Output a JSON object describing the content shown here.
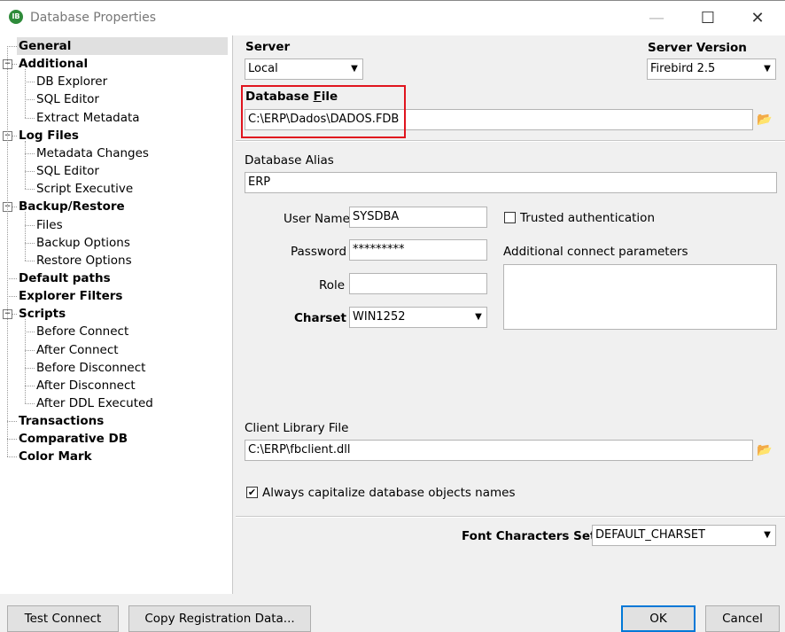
{
  "window": {
    "app_icon_text": "IB",
    "title": "Database Properties",
    "minimize_glyph": "—",
    "maximize_glyph": "☐",
    "close_glyph": "✕"
  },
  "tree": {
    "items": [
      {
        "label": "General",
        "bold": true,
        "level": 0,
        "selected": true
      },
      {
        "label": "Additional",
        "bold": true,
        "level": 0,
        "expander": "−"
      },
      {
        "label": "DB Explorer",
        "level": 1
      },
      {
        "label": "SQL Editor",
        "level": 1
      },
      {
        "label": "Extract Metadata",
        "level": 1
      },
      {
        "label": "Log Files",
        "bold": true,
        "level": 0,
        "expander": "−"
      },
      {
        "label": "Metadata Changes",
        "level": 1
      },
      {
        "label": "SQL Editor",
        "level": 1
      },
      {
        "label": "Script Executive",
        "level": 1
      },
      {
        "label": "Backup/Restore",
        "bold": true,
        "level": 0,
        "expander": "−"
      },
      {
        "label": "Files",
        "level": 1
      },
      {
        "label": "Backup Options",
        "level": 1
      },
      {
        "label": "Restore Options",
        "level": 1
      },
      {
        "label": "Default paths",
        "bold": true,
        "level": 0
      },
      {
        "label": "Explorer Filters",
        "bold": true,
        "level": 0
      },
      {
        "label": "Scripts",
        "bold": true,
        "level": 0,
        "expander": "−"
      },
      {
        "label": "Before Connect",
        "level": 1
      },
      {
        "label": "After Connect",
        "level": 1
      },
      {
        "label": "Before Disconnect",
        "level": 1
      },
      {
        "label": "After Disconnect",
        "level": 1
      },
      {
        "label": "After DDL Executed",
        "level": 1
      },
      {
        "label": "Transactions",
        "bold": true,
        "level": 0
      },
      {
        "label": "Comparative DB",
        "bold": true,
        "level": 0
      },
      {
        "label": "Color Mark",
        "bold": true,
        "level": 0
      }
    ]
  },
  "form": {
    "server_label": "Server",
    "server_value": "Local",
    "server_version_label": "Server Version",
    "server_version_value": "Firebird 2.5",
    "database_file_label_pre": "Database ",
    "database_file_label_acc": "F",
    "database_file_label_post": "ile",
    "database_file_value": "C:\\ERP\\Dados\\DADOS.FDB",
    "database_alias_label": "Database Alias",
    "database_alias_value": "ERP",
    "user_name_label": "User Name",
    "user_name_value": "SYSDBA",
    "trusted_auth_label": "Trusted authentication",
    "trusted_auth_checked": false,
    "password_label": "Password",
    "password_value": "*********",
    "additional_params_label": "Additional connect parameters",
    "role_label": "Role",
    "role_value": "",
    "charset_label": "Charset",
    "charset_value": "WIN1252",
    "client_library_label": "Client Library File",
    "client_library_value": "C:\\ERP\\fbclient.dll",
    "capitalize_label": "Always capitalize database objects names",
    "capitalize_checked": true,
    "font_charset_label": "Font Characters Set",
    "font_charset_value": "DEFAULT_CHARSET",
    "dropdown_arrow": "▼",
    "folder_icon": "📂",
    "check_glyph": "✔"
  },
  "buttons": {
    "test_connect": "Test Connect",
    "copy_registration": "Copy Registration Data...",
    "ok": "OK",
    "cancel": "Cancel"
  },
  "colors": {
    "highlight_box": "#e0141e",
    "ok_border": "#0078d7"
  }
}
